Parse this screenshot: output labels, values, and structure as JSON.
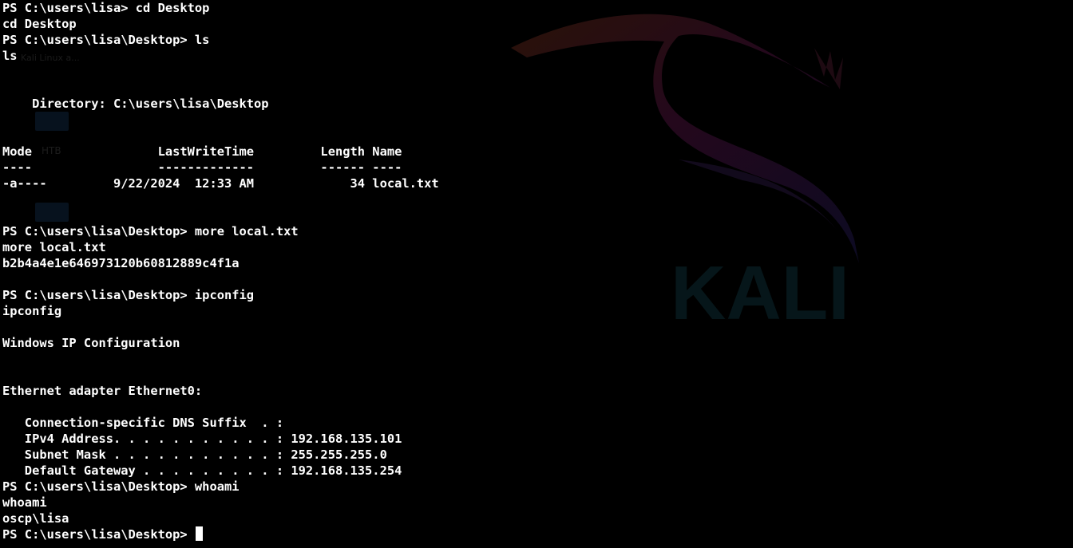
{
  "watermark": {
    "text": "KALI",
    "ghost_text": "Kali Linux a...",
    "ghost_label": "HTB"
  },
  "terminal": {
    "lines": [
      "PS C:\\users\\lisa> cd Desktop",
      "cd Desktop",
      "PS C:\\users\\lisa\\Desktop> ls",
      "ls",
      "",
      "",
      "    Directory: C:\\users\\lisa\\Desktop",
      "",
      "",
      "Mode                 LastWriteTime         Length Name",
      "----                 -------------         ------ ----",
      "-a----         9/22/2024  12:33 AM             34 local.txt",
      "",
      "",
      "PS C:\\users\\lisa\\Desktop> more local.txt",
      "more local.txt",
      "b2b4a4e1e646973120b60812889c4f1a",
      "",
      "PS C:\\users\\lisa\\Desktop> ipconfig",
      "ipconfig",
      "",
      "Windows IP Configuration",
      "",
      "",
      "Ethernet adapter Ethernet0:",
      "",
      "   Connection-specific DNS Suffix  . :",
      "   IPv4 Address. . . . . . . . . . . : 192.168.135.101",
      "   Subnet Mask . . . . . . . . . . . : 255.255.255.0",
      "   Default Gateway . . . . . . . . . : 192.168.135.254",
      "PS C:\\users\\lisa\\Desktop> whoami",
      "whoami",
      "oscp\\lisa"
    ],
    "prompt": "PS C:\\users\\lisa\\Desktop> "
  }
}
